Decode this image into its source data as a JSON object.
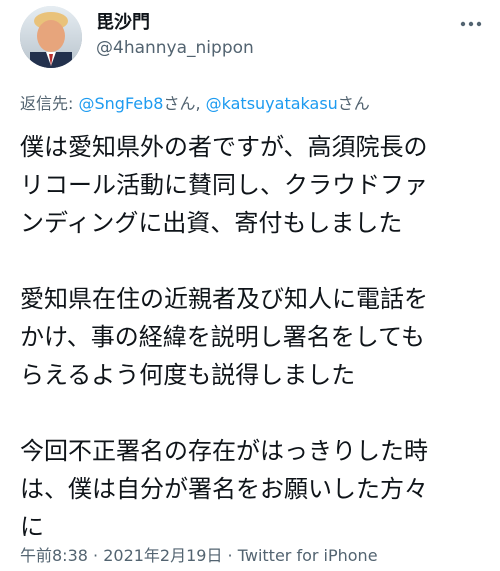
{
  "author": {
    "display_name": "毘沙門",
    "handle": "@4hannya_nippon",
    "avatar_icon": "avatar-photo"
  },
  "menu_icon": "more-horizontal-icon",
  "reply_to": {
    "prefix": "返信先: ",
    "mention_1": "@SngFeb8",
    "san_1": "さん",
    "separator": ", ",
    "mention_2": "@katsuyatakasu",
    "san_2": "さん"
  },
  "body": {
    "paragraph_1": "僕は愛知県外の者ですが、高須院長の\nリコール活動に賛同し、クラウドファ\nンディングに出資、寄付もしました",
    "paragraph_2": "愛知県在住の近親者及び知人に電話を\nかけ、事の経緯を説明し署名をしても\nらえるよう何度も説得しました",
    "paragraph_3": "今回不正署名の存在がはっきりした時\nは、僕は自分が署名をお願いした方々\nに"
  },
  "meta": {
    "time": "午前8:38",
    "dot_1": " · ",
    "date": "2021年2月19日",
    "dot_2": " · ",
    "source": "Twitter for iPhone"
  },
  "colors": {
    "text": "#0f1419",
    "secondary": "#536471",
    "link": "#1d9bf0",
    "background": "#ffffff"
  }
}
